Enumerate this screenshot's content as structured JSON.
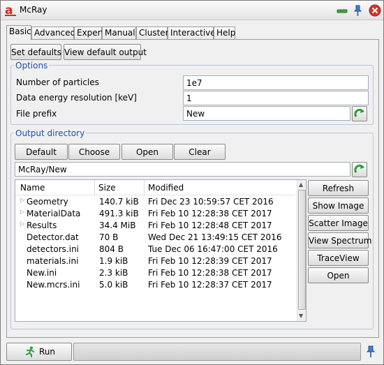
{
  "window": {
    "title": "McRay"
  },
  "tabs": [
    {
      "label": "Basic",
      "active": true
    },
    {
      "label": "Advanced"
    },
    {
      "label": "Expert"
    },
    {
      "label": "Manual"
    },
    {
      "label": "Cluster"
    },
    {
      "label": "Interactive"
    },
    {
      "label": "Help"
    }
  ],
  "toolbar": {
    "set_defaults": "Set defaults",
    "view_default_output": "View default output"
  },
  "options": {
    "title": "Options",
    "particles_label": "Number of particles",
    "particles_value": "1e7",
    "energy_label": "Data energy resolution [keV]",
    "energy_value": "1",
    "prefix_label": "File prefix",
    "prefix_value": "New"
  },
  "output": {
    "title": "Output directory",
    "buttons": {
      "default": "Default",
      "choose": "Choose",
      "open": "Open",
      "clear": "Clear"
    },
    "path": "McRay/New"
  },
  "filelist": {
    "headers": {
      "name": "Name",
      "size": "Size",
      "modified": "Modified"
    },
    "rows": [
      {
        "name": "Geometry",
        "size": "140.7 kiB",
        "modified": "Fri Dec 23 10:59:57 CET 2016",
        "folder": true
      },
      {
        "name": "MaterialData",
        "size": "491.3 kiB",
        "modified": "Fri Feb 10 12:28:38 CET 2017",
        "folder": true
      },
      {
        "name": "Results",
        "size": "34.4 MiB",
        "modified": "Fri Feb 10 12:28:48 CET 2017",
        "folder": true
      },
      {
        "name": "Detector.dat",
        "size": "70 B",
        "modified": "Wed Dec 21 13:49:15 CET 2016",
        "folder": false
      },
      {
        "name": "detectors.ini",
        "size": "804 B",
        "modified": "Tue Dec 06 16:47:00 CET 2016",
        "folder": false
      },
      {
        "name": "materials.ini",
        "size": "1.9 kiB",
        "modified": "Fri Feb 10 12:28:39 CET 2017",
        "folder": false
      },
      {
        "name": "New.ini",
        "size": "2.3 kiB",
        "modified": "Fri Feb 10 12:28:38 CET 2017",
        "folder": false
      },
      {
        "name": "New.mcrs.ini",
        "size": "5.0 kiB",
        "modified": "Fri Feb 10 12:28:37 CET 2017",
        "folder": false
      }
    ]
  },
  "side_buttons": {
    "refresh": "Refresh",
    "show_image": "Show Image",
    "scatter_image": "Scatter Image",
    "view_spectrum": "View Spectrum",
    "traceview": "TraceView",
    "open": "Open"
  },
  "bottom": {
    "run": "Run"
  },
  "colors": {
    "group_title": "#1f4fa5",
    "refresh_green": "#2e9e3a",
    "close_red": "#d9332b"
  }
}
